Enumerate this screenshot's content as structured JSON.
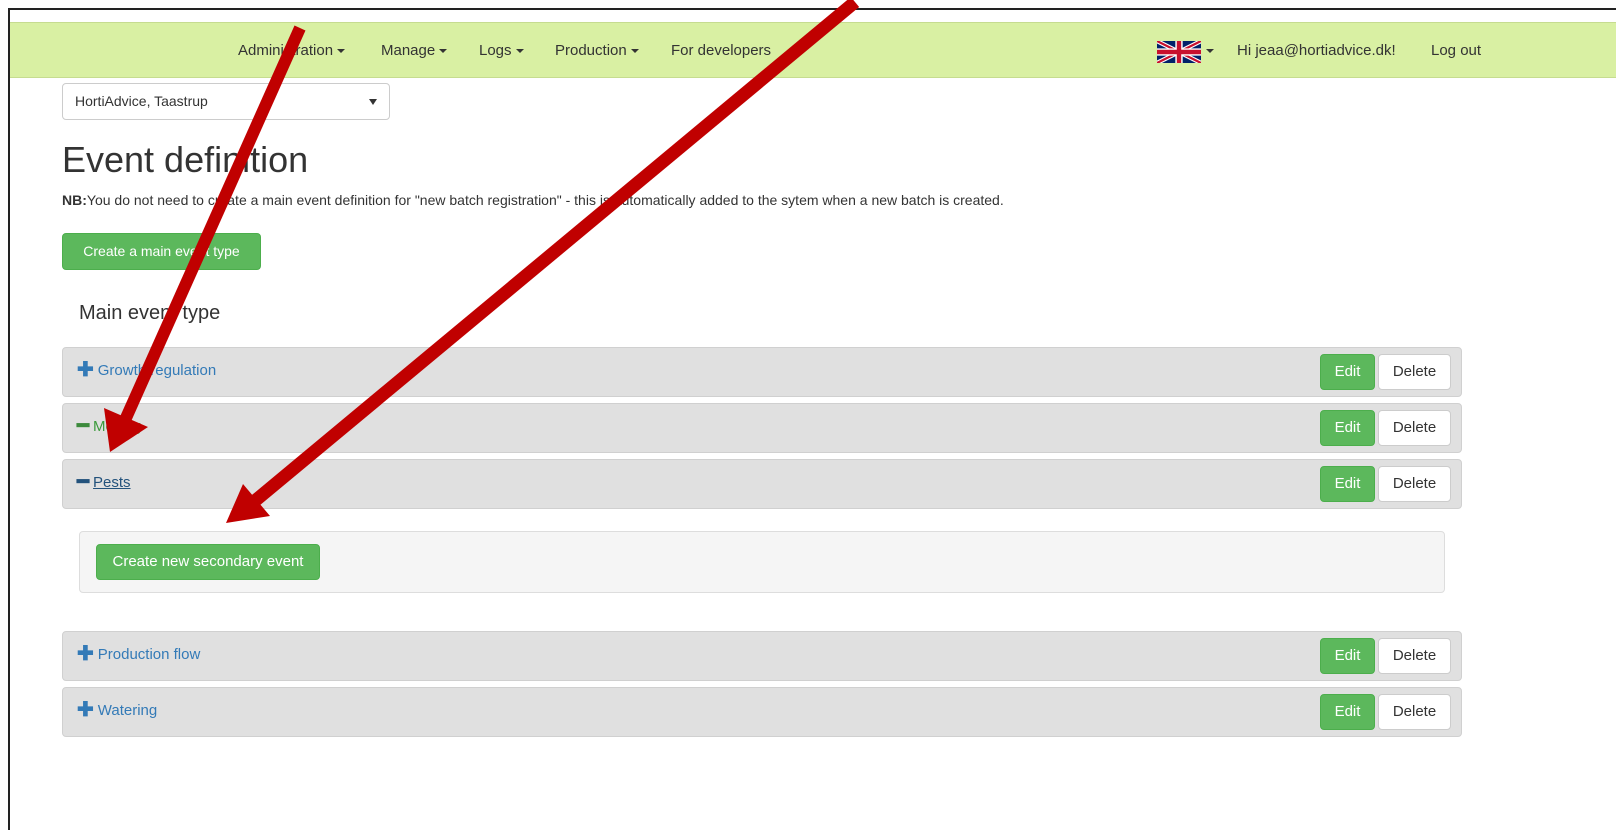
{
  "navbar": {
    "menu": [
      {
        "label": "Administration",
        "dropdown": true
      },
      {
        "label": "Manage",
        "dropdown": true
      },
      {
        "label": "Logs",
        "dropdown": true
      },
      {
        "label": "Production",
        "dropdown": true
      },
      {
        "label": "For developers",
        "dropdown": false
      }
    ],
    "language_icon": "uk-flag-icon",
    "greeting": "Hi jeaa@hortiadvice.dk!",
    "logout": "Log out",
    "bg_color": "#d9f0a3"
  },
  "site_select": {
    "value": "HortiAdvice, Taastrup"
  },
  "page": {
    "title": "Event definition",
    "note_label": "NB:",
    "note_text": "You do not need to create a main event definition for \"new batch registration\" - this is automatically added to the sytem when a new batch is created.",
    "create_main_button": "Create a main event type",
    "section_heading": "Main event type"
  },
  "events": [
    {
      "name": "Growth regulation",
      "expanded": false
    },
    {
      "name": "Moving",
      "expanded": true
    },
    {
      "name": "Pests",
      "expanded": true
    },
    {
      "name": "Production flow",
      "expanded": false
    },
    {
      "name": "Watering",
      "expanded": false
    }
  ],
  "row_actions": {
    "edit": "Edit",
    "delete": "Delete"
  },
  "sub_panel": {
    "create_secondary_button": "Create new secondary event"
  },
  "colors": {
    "green_button": "#5cb85c",
    "link_blue": "#337ab7",
    "annotation_arrow": "#c00000"
  }
}
